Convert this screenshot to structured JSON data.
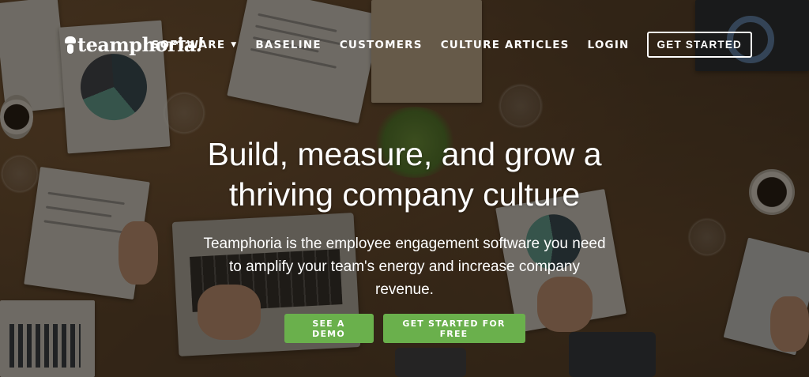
{
  "brand": {
    "name": "teamphoria",
    "suffix": "!"
  },
  "nav": {
    "items": [
      {
        "label": "SOFTWARE",
        "has_dropdown": true
      },
      {
        "label": "BASELINE"
      },
      {
        "label": "CUSTOMERS"
      },
      {
        "label": "CULTURE ARTICLES"
      },
      {
        "label": "LOGIN"
      }
    ],
    "cta": "GET STARTED"
  },
  "hero": {
    "headline_line1": "Build, measure, and grow a",
    "headline_line2": "thriving company culture",
    "sub_line1": "Teamphoria is the employee engagement software you need",
    "sub_line2": "to amplify your team's energy and increase company",
    "sub_line3": "revenue.",
    "demo_button": "SEE A DEMO",
    "start_button": "GET STARTED FOR FREE"
  },
  "colors": {
    "accent_green": "#6ab04c",
    "overlay": "rgba(20,14,8,0.55)",
    "text": "#ffffff"
  },
  "icons": {
    "logo_mark": "chef-icon",
    "dropdown": "chevron-down-icon"
  }
}
